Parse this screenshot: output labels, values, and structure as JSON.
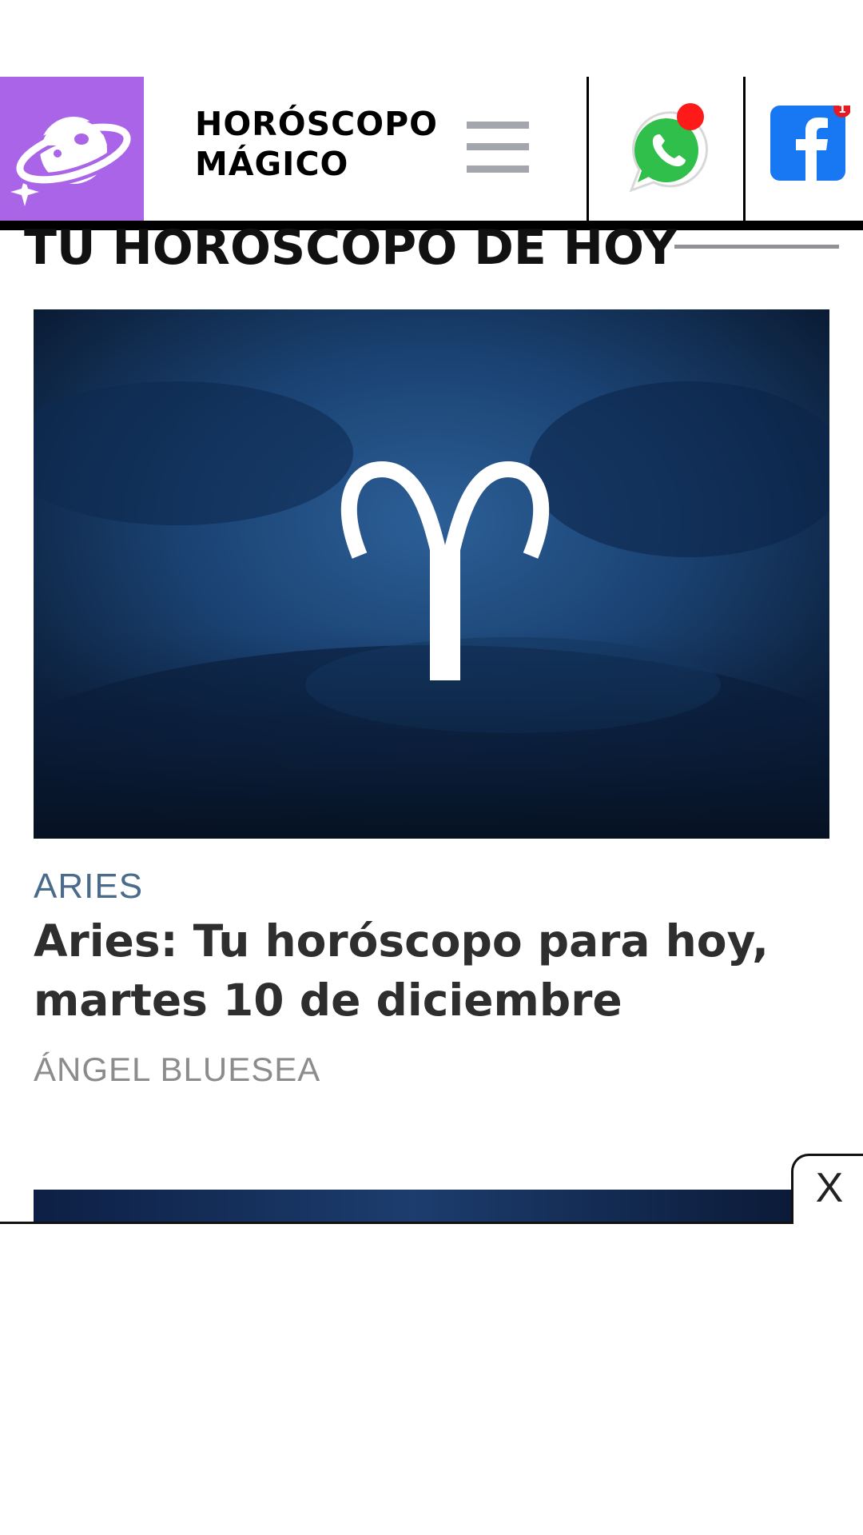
{
  "header": {
    "site_title_line1": "HORÓSCOPO",
    "site_title_line2": "MÁGICO",
    "brand_color": "#a964e8",
    "facebook_badge_count": "1"
  },
  "section": {
    "title": "TU HOROSCOPO DE HOY"
  },
  "article": {
    "category": "ARIES",
    "headline": "Aries: Tu horóscopo para hoy, martes 10 de diciembre",
    "author": "ÁNGEL BLUESEA"
  },
  "overlay": {
    "close_label": "X"
  }
}
